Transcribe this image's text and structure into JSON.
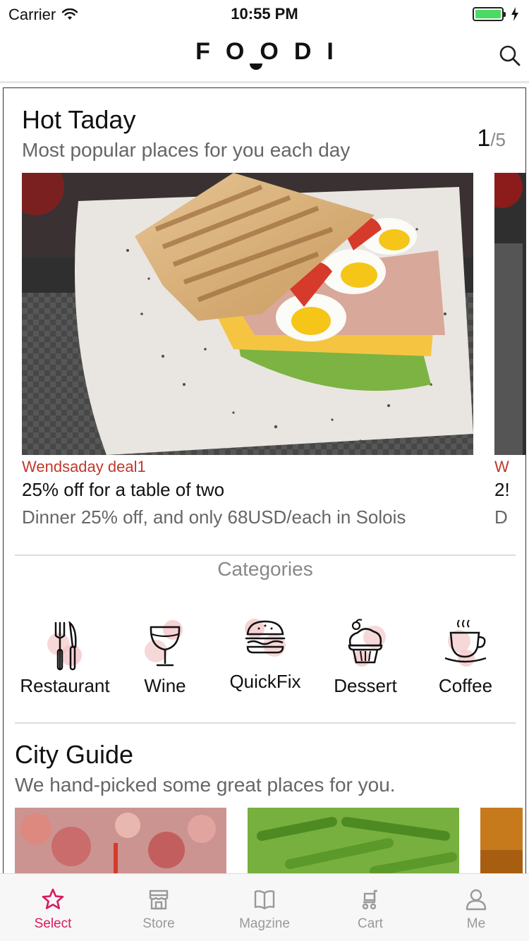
{
  "status_bar": {
    "carrier": "Carrier",
    "time": "10:55 PM",
    "battery_level": 1.0
  },
  "nav": {
    "logo": "FOODI",
    "search_icon": "search-icon"
  },
  "hot_today": {
    "title": "Hot Taday",
    "subtitle": "Most popular places for you each day",
    "page_current": "1",
    "page_total": "/5",
    "deals": [
      {
        "tag": "Wendsaday deal1",
        "title": "25% off for a table of two",
        "description": "Dinner 25% off, and only 68USD/each in Solois"
      },
      {
        "tag": "W",
        "title": "2!",
        "description": "D"
      }
    ]
  },
  "categories": {
    "label": "Categories",
    "items": [
      {
        "label": "Restaurant",
        "icon": "cutlery-icon"
      },
      {
        "label": "Wine",
        "icon": "wine-glass-icon"
      },
      {
        "label": "QuickFix",
        "icon": "burger-icon"
      },
      {
        "label": "Dessert",
        "icon": "cupcake-icon"
      },
      {
        "label": "Coffee",
        "icon": "coffee-cup-icon"
      }
    ]
  },
  "city_guide": {
    "title": "City Guide",
    "subtitle": "We hand-picked some great places for you."
  },
  "tab_bar": {
    "items": [
      {
        "label": "Select",
        "icon": "star-icon",
        "active": true
      },
      {
        "label": "Store",
        "icon": "store-icon",
        "active": false
      },
      {
        "label": "Magzine",
        "icon": "book-icon",
        "active": false
      },
      {
        "label": "Cart",
        "icon": "cart-icon",
        "active": false
      },
      {
        "label": "Me",
        "icon": "user-icon",
        "active": false
      }
    ]
  },
  "colors": {
    "accent": "#d81b60",
    "deal_tag": "#c0392b",
    "icon_blob": "#f4c7c9"
  }
}
